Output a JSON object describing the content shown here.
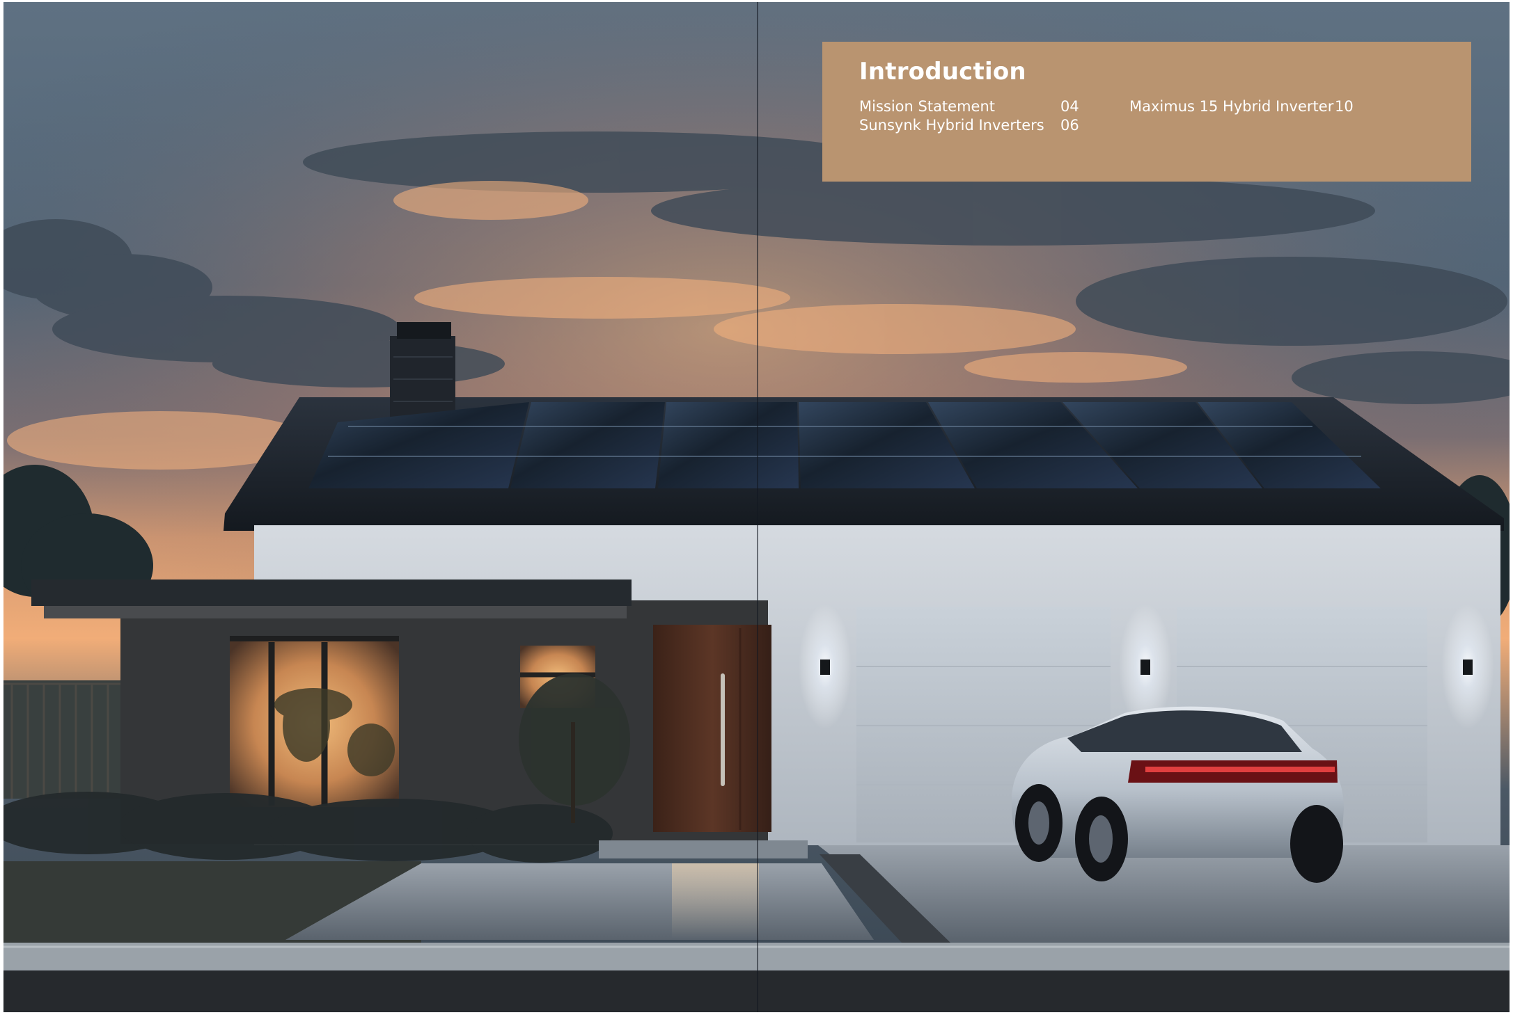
{
  "toc": {
    "title": "Introduction",
    "entries": [
      {
        "label": "Mission Statement",
        "page": "04"
      },
      {
        "label": "Sunsynk Hybrid Inverters",
        "page": "06"
      },
      {
        "label": "Maximus 15 Hybrid Inverter",
        "page": "10"
      }
    ]
  },
  "colors": {
    "toc_panel": "#b99470",
    "toc_text": "#ffffff",
    "sky": "#56687a",
    "sunset": "#f0a270",
    "house_wall": "#d9dde2",
    "roof": "#1e252f",
    "solar_panels": "#1c2735",
    "window_glow": "#d59b5f",
    "car": "#b8c0c9"
  },
  "image": {
    "subject": "modern single-storey house with rooftop solar panels at dusk and a silver electric car in the driveway"
  }
}
